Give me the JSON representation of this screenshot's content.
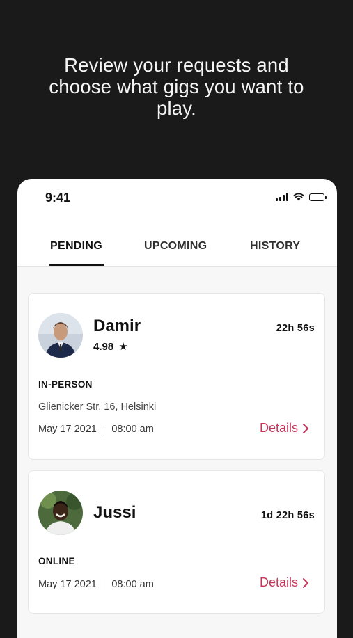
{
  "headline": {
    "line1": "Review your requests and",
    "line2": "choose what gigs you want to",
    "line3": "play."
  },
  "status_bar": {
    "time": "9:41",
    "icons": [
      "signal-icon",
      "wifi-icon",
      "battery-icon"
    ]
  },
  "tabs": [
    {
      "label": "PENDING",
      "active": true
    },
    {
      "label": "UPCOMING",
      "active": false
    },
    {
      "label": "HISTORY",
      "active": false
    }
  ],
  "requests": [
    {
      "name": "Damir",
      "rating": "4.98",
      "timer": "22h 56s",
      "type": "IN-PERSON",
      "address": "Glienicker Str. 16, Helsinki",
      "date": "May 17 2021",
      "time": "08:00 am",
      "details_label": "Details"
    },
    {
      "name": "Jussi",
      "timer": "1d 22h 56s",
      "type": "ONLINE",
      "date": "May 17 2021",
      "time": "08:00 am",
      "details_label": "Details"
    }
  ],
  "colors": {
    "accent": "#c6365b",
    "background": "#1b1a1b",
    "card": "#ffffff"
  }
}
